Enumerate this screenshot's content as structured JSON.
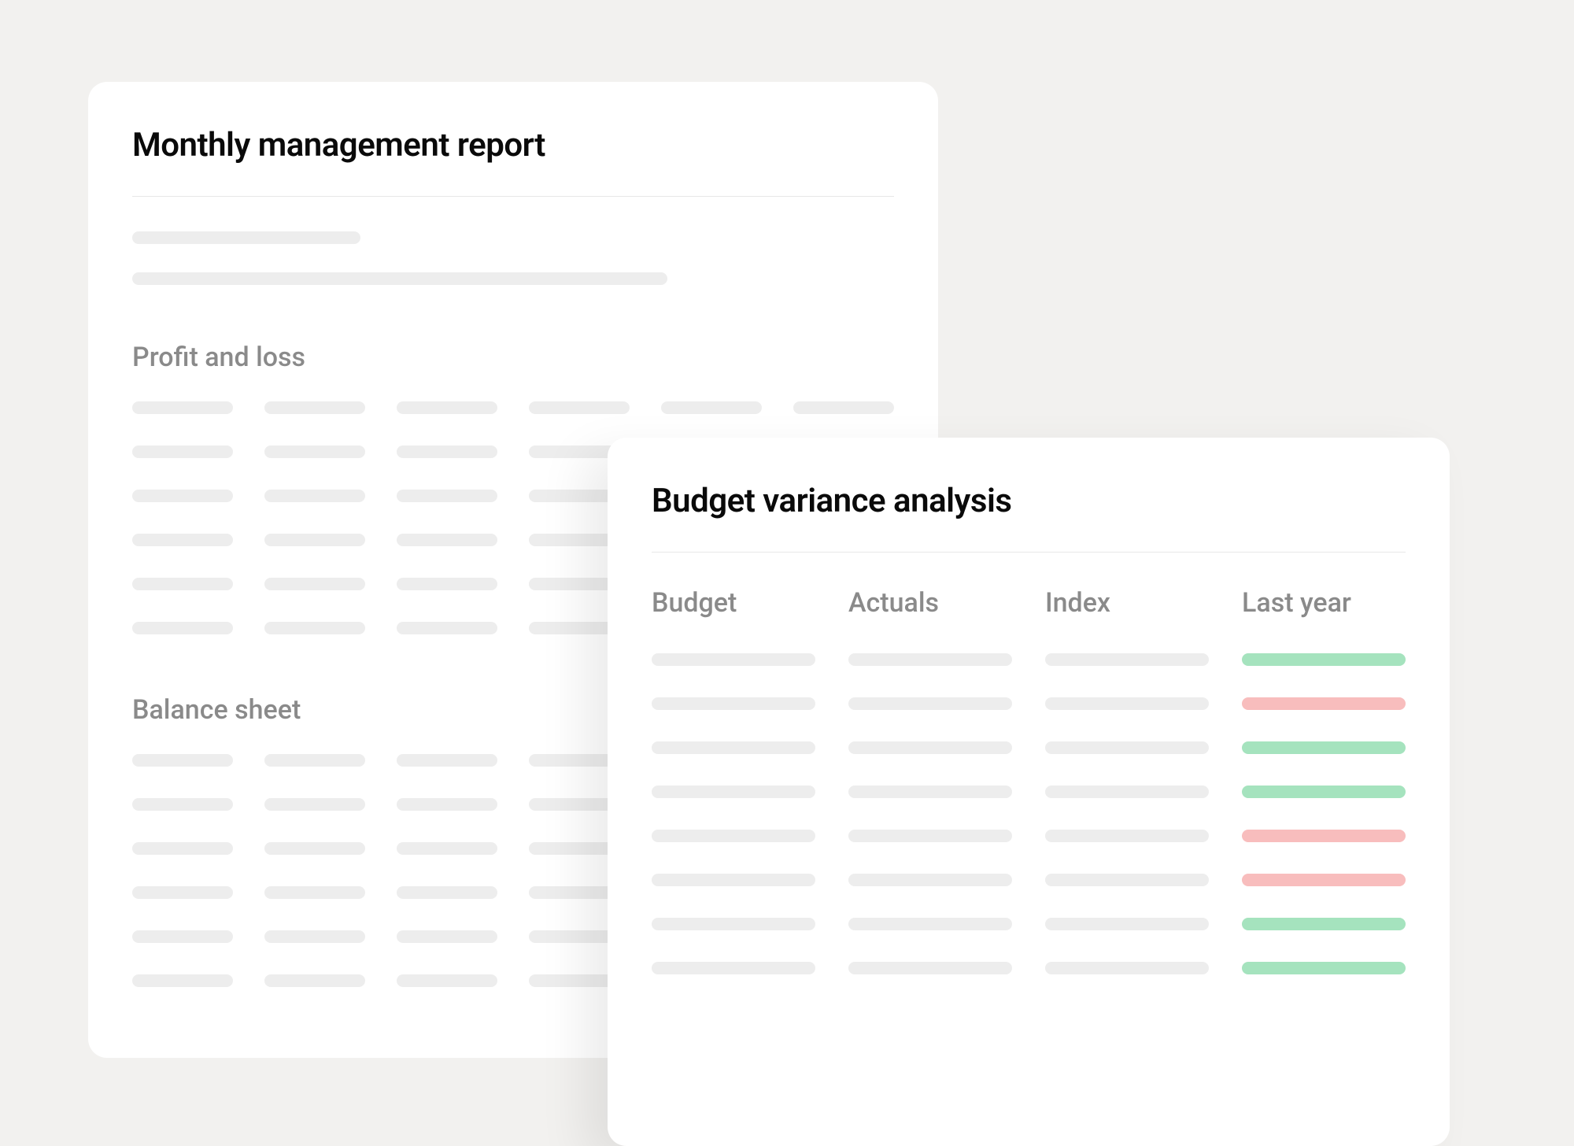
{
  "report": {
    "title": "Monthly management report",
    "sections": {
      "profit_loss": {
        "title": "Profit and loss",
        "rows": 6,
        "cols": 6
      },
      "balance_sheet": {
        "title": "Balance sheet",
        "rows": 6,
        "cols": 6
      }
    }
  },
  "variance": {
    "title": "Budget variance analysis",
    "columns": [
      "Budget",
      "Actuals",
      "Index",
      "Last year"
    ],
    "last_year_status": [
      "green",
      "red",
      "green",
      "green",
      "red",
      "red",
      "green",
      "green"
    ]
  },
  "colors": {
    "background": "#f2f1ef",
    "card": "#ffffff",
    "text_primary": "#0a0a0a",
    "text_secondary": "#8a8a8a",
    "skeleton": "#ededed",
    "positive": "#a5e3be",
    "negative": "#f8bdbd",
    "divider": "#e8e8e8"
  }
}
